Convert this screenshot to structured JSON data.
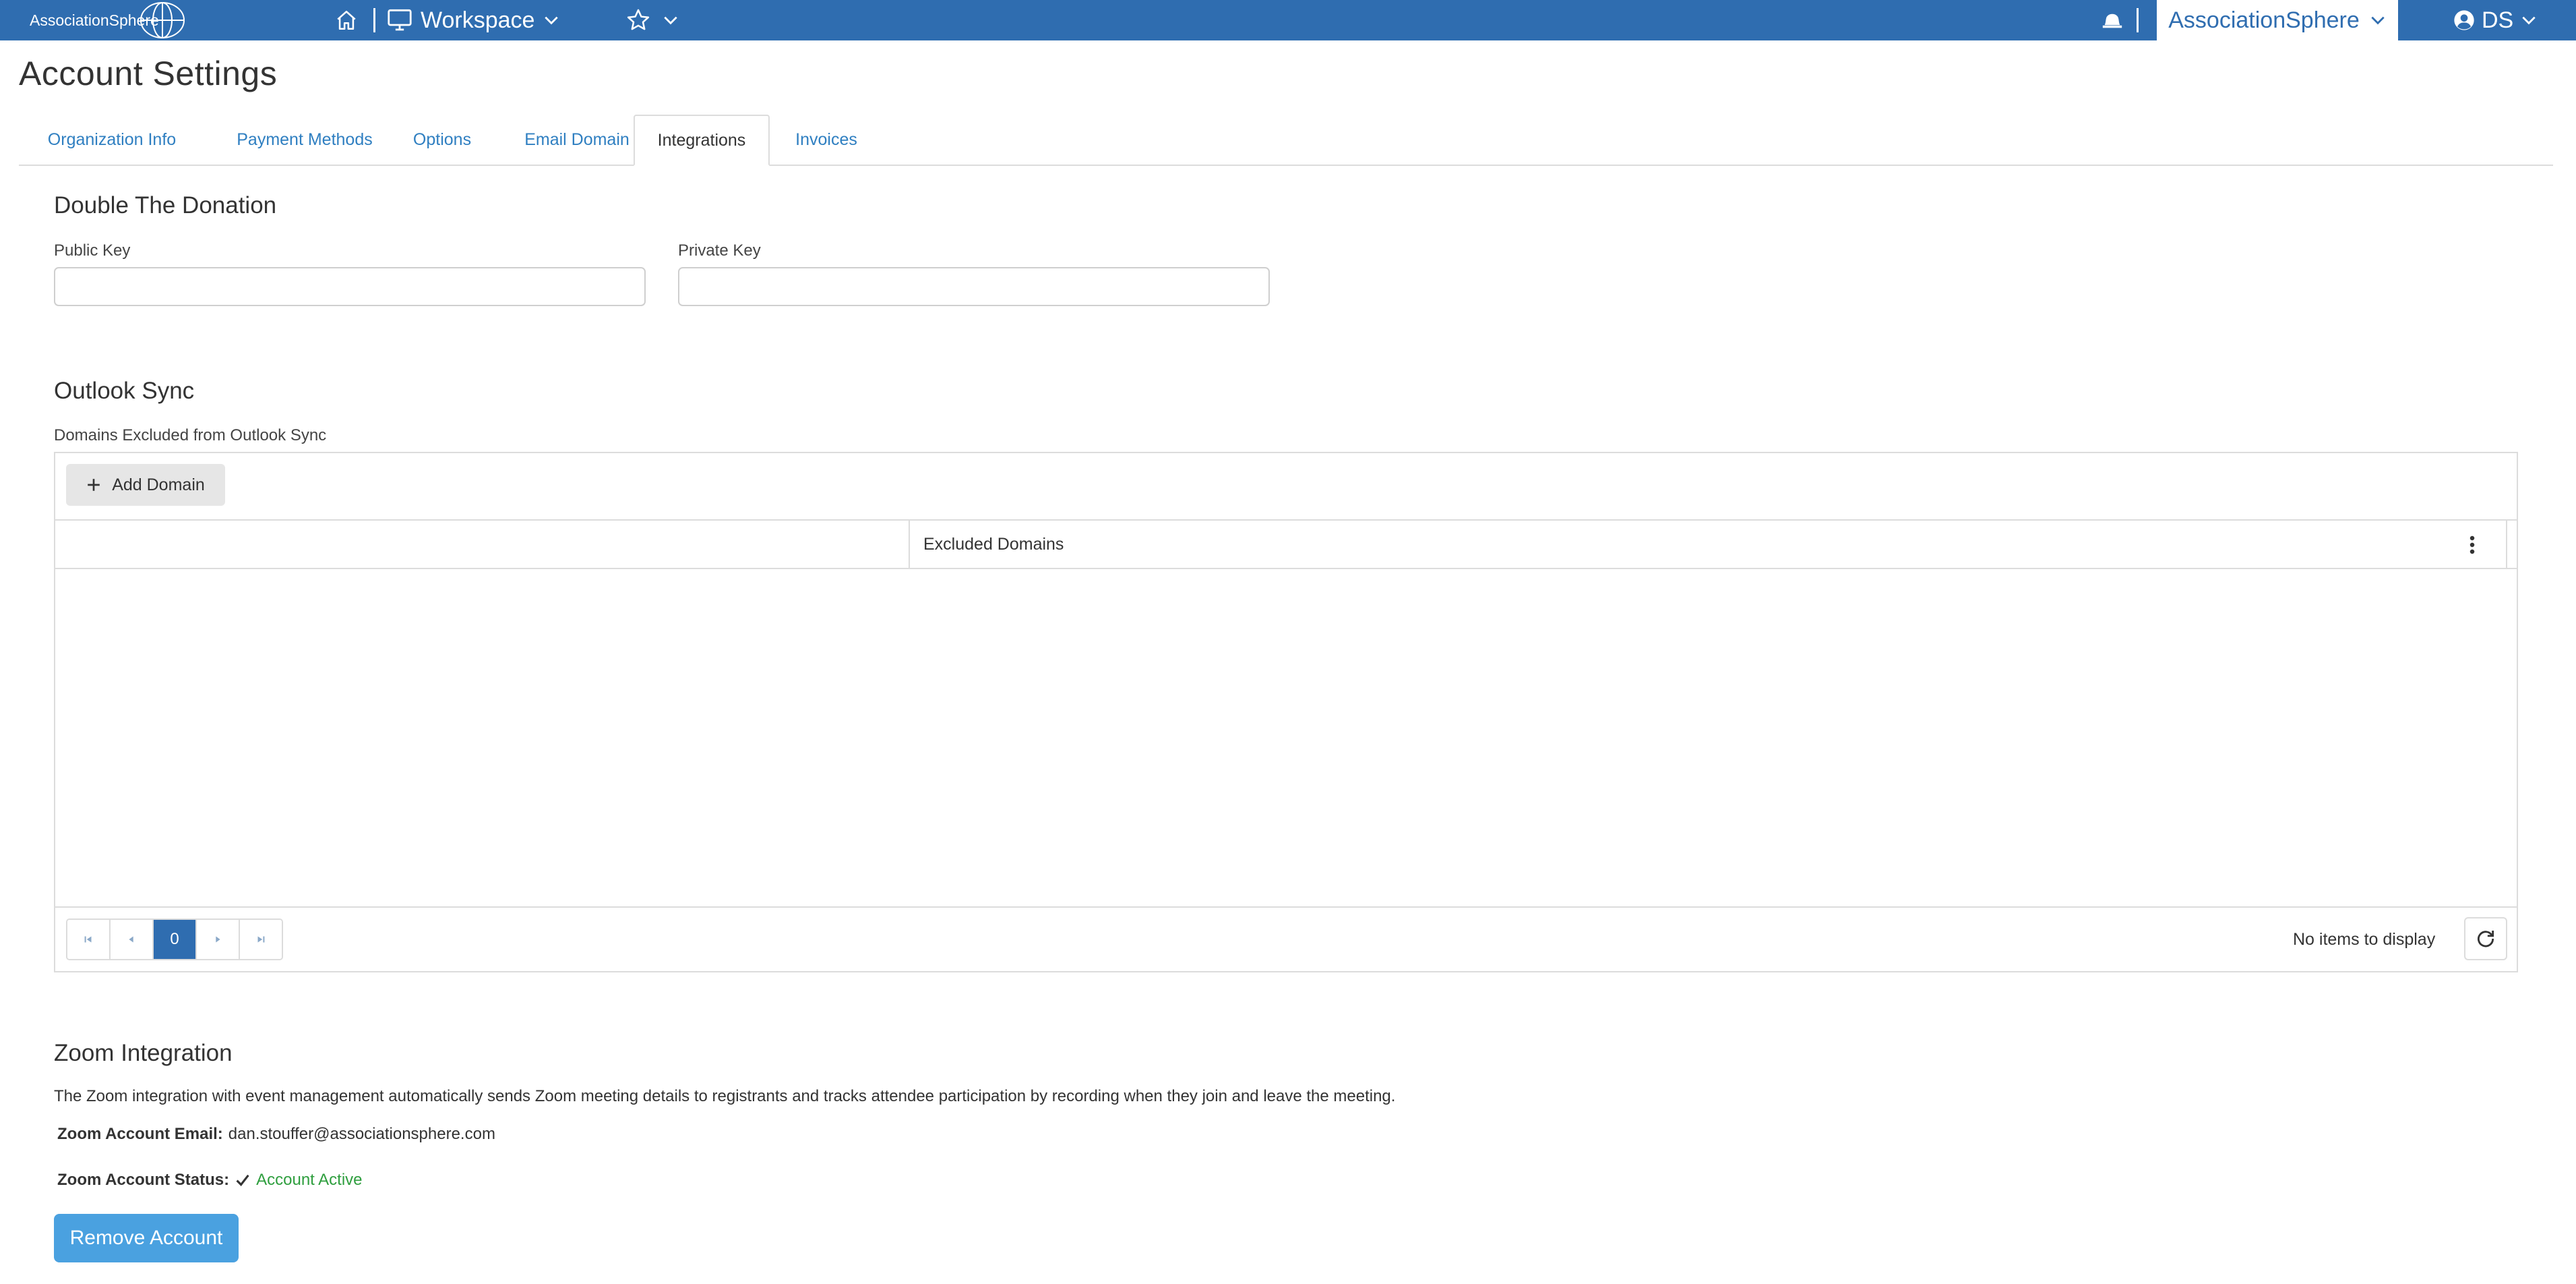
{
  "topbar": {
    "logo_text": "AssociationSphere",
    "workspace_label": "Workspace",
    "org_name": "AssociationSphere",
    "user_initials": "DS"
  },
  "page": {
    "title": "Account Settings"
  },
  "tabs": [
    {
      "label": "Organization Info"
    },
    {
      "label": "Payment Methods"
    },
    {
      "label": "Options"
    },
    {
      "label": "Email Domain"
    },
    {
      "label": "Integrations"
    },
    {
      "label": "Invoices"
    }
  ],
  "double_donation": {
    "heading": "Double The Donation",
    "public_key_label": "Public Key",
    "public_key_value": "",
    "private_key_label": "Private Key",
    "private_key_value": ""
  },
  "outlook": {
    "heading": "Outlook Sync",
    "grid_label": "Domains Excluded from Outlook Sync",
    "add_button": "Add Domain",
    "column_header": "Excluded Domains",
    "current_page": "0",
    "empty_text": "No items to display"
  },
  "zoom": {
    "heading": "Zoom Integration",
    "description": "The Zoom integration with event management automatically sends Zoom meeting details to registrants and tracks attendee participation by recording when they join and leave the meeting.",
    "email_label": "Zoom Account Email:",
    "email_value": "dan.stouffer@associationsphere.com",
    "status_label": "Zoom Account Status:",
    "status_value": "Account Active",
    "remove_button": "Remove Account"
  },
  "colors": {
    "brand": "#2f6db0",
    "link": "#2f7fc1",
    "success": "#2e9e3e",
    "button": "#4aa1e0"
  }
}
